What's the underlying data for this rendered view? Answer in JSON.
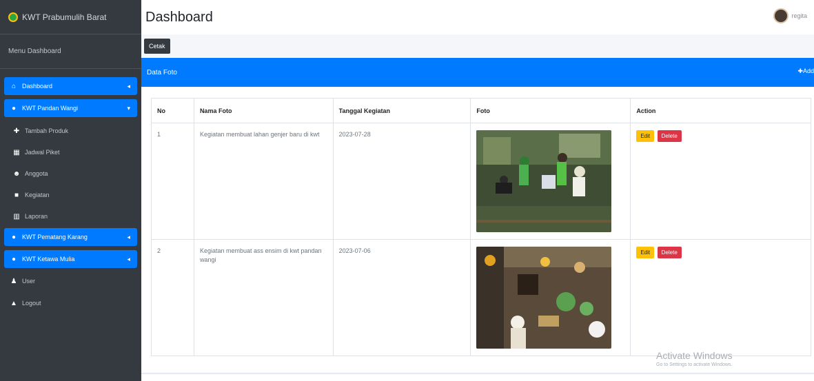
{
  "brand": {
    "title": "KWT Prabumulih Barat"
  },
  "sidebar": {
    "menu_header": "Menu Dashboard",
    "items": [
      {
        "label": "Dashboard",
        "icon": "home-icon",
        "active": true
      },
      {
        "label": "KWT Pandan Wangi",
        "icon": "avatar-icon",
        "active": true
      },
      {
        "label": "Tambah Produk",
        "icon": "plus-icon"
      },
      {
        "label": "Jadwal Piket",
        "icon": "table-icon"
      },
      {
        "label": "Anggota",
        "icon": "users-icon"
      },
      {
        "label": "Kegiatan",
        "icon": "camera-icon"
      },
      {
        "label": "Laporan",
        "icon": "chart-icon"
      },
      {
        "label": "KWT Pematang Karang",
        "icon": "avatar-icon",
        "active": true
      },
      {
        "label": "KWT Ketawa Mulia",
        "icon": "avatar-icon",
        "active": true
      },
      {
        "label": "User",
        "icon": "user-icon"
      },
      {
        "label": "Logout",
        "icon": "lock-icon"
      }
    ]
  },
  "header": {
    "title": "Dashboard",
    "user_name": "regita"
  },
  "toolbar": {
    "cetak_label": "Cetak"
  },
  "card": {
    "title": "Data Foto",
    "add_label": "✚Add"
  },
  "table": {
    "headers": [
      "No",
      "Nama Foto",
      "Tanggal Kegiatan",
      "Foto",
      "Action"
    ],
    "rows": [
      {
        "no": "1",
        "nama": "Kegiatan membuat lahan genjer baru di kwt",
        "tanggal": "2023-07-28"
      },
      {
        "no": "2",
        "nama": "Kegiatan membuat ass ensim di kwt pandan wangi",
        "tanggal": "2023-07-06"
      }
    ],
    "edit_label": "Edit",
    "delete_label": "Delete"
  },
  "watermark": {
    "title": "Activate Windows",
    "subtitle": "Go to Settings to activate Windows."
  },
  "colors": {
    "sidebar": "#343a40",
    "primary": "#007bff",
    "edit": "#ffc107",
    "delete": "#dc3545"
  }
}
